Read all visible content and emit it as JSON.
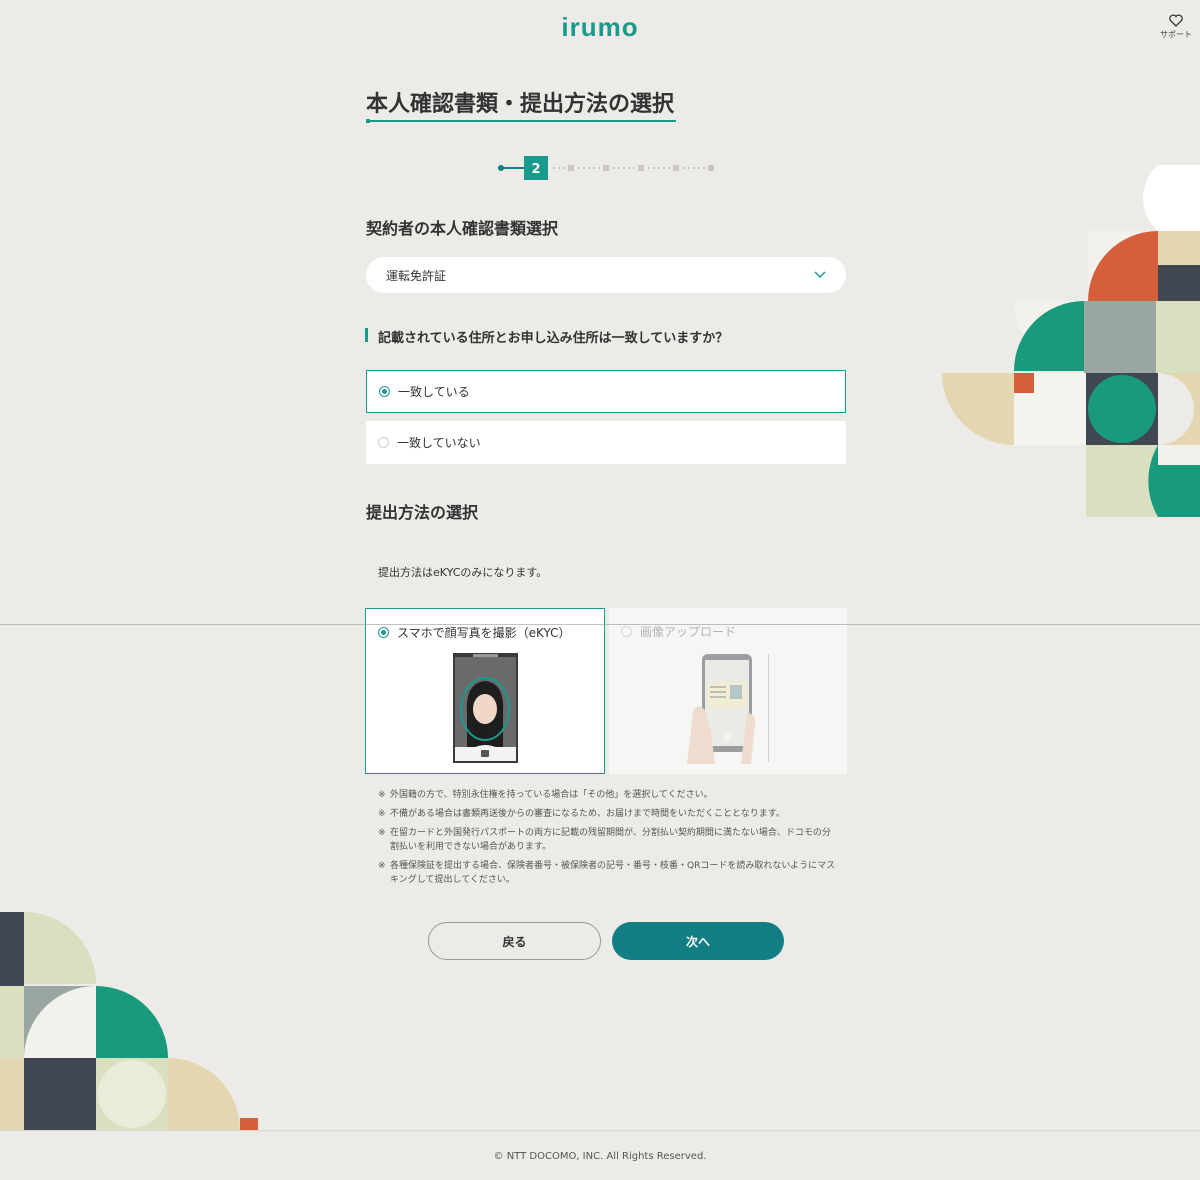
{
  "header": {
    "logo": "irumo",
    "support_label": "サポート"
  },
  "page": {
    "title": "本人確認書類・提出方法の選択"
  },
  "stepper": {
    "current_step": "2",
    "total_steps": 7
  },
  "document_section": {
    "heading": "契約者の本人確認書類選択",
    "select_value": "運転免許証"
  },
  "address_question": {
    "question": "記載されている住所とお申し込み住所は一致していますか？",
    "options": [
      {
        "label": "一致している",
        "selected": true
      },
      {
        "label": "一致していない",
        "selected": false
      }
    ]
  },
  "submit_section": {
    "heading": "提出方法の選択",
    "note": "提出方法はeKYCのみになります。",
    "methods": [
      {
        "label": "スマホで顔写真を撮影（eKYC）",
        "selected": true,
        "enabled": true
      },
      {
        "label": "画像アップロード",
        "selected": false,
        "enabled": false
      }
    ]
  },
  "notes": {
    "mark": "※",
    "items": [
      "外国籍の方で、特別永住権を持っている場合は「その他」を選択してください。",
      "不備がある場合は書類再送後からの審査になるため、お届けまで時間をいただくこととなります。",
      "在留カードと外国発行パスポートの両方に記載の残留期間が、分割払い契約期間に満たない場合、ドコモの分割払いを利用できない場合があります。",
      "各種保険証を提出する場合、保険者番号・被保険者の記号・番号・枝番・QRコードを読み取れないようにマスキングして提出してください。"
    ]
  },
  "buttons": {
    "back": "戻る",
    "next": "次へ"
  },
  "footer": {
    "copyright": "© NTT DOCOMO, INC. All Rights Reserved."
  },
  "colors": {
    "accent": "#1a9a8c",
    "primary_button": "#137f84",
    "background": "#ecebe7"
  }
}
